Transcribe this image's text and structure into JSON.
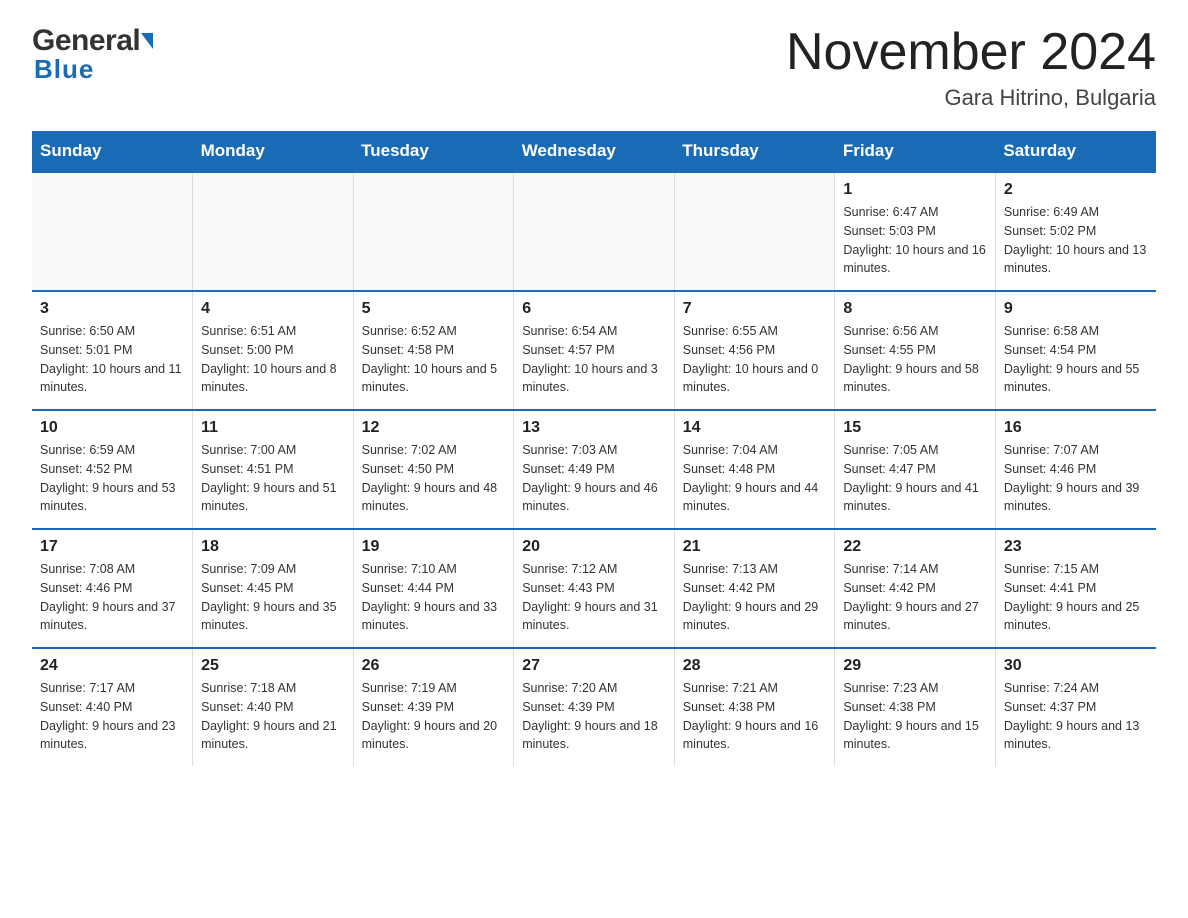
{
  "header": {
    "title": "November 2024",
    "subtitle": "Gara Hitrino, Bulgaria",
    "logo_general": "General",
    "logo_blue": "Blue"
  },
  "days_of_week": [
    "Sunday",
    "Monday",
    "Tuesday",
    "Wednesday",
    "Thursday",
    "Friday",
    "Saturday"
  ],
  "weeks": [
    [
      {
        "day": "",
        "info": ""
      },
      {
        "day": "",
        "info": ""
      },
      {
        "day": "",
        "info": ""
      },
      {
        "day": "",
        "info": ""
      },
      {
        "day": "",
        "info": ""
      },
      {
        "day": "1",
        "info": "Sunrise: 6:47 AM\nSunset: 5:03 PM\nDaylight: 10 hours and 16 minutes."
      },
      {
        "day": "2",
        "info": "Sunrise: 6:49 AM\nSunset: 5:02 PM\nDaylight: 10 hours and 13 minutes."
      }
    ],
    [
      {
        "day": "3",
        "info": "Sunrise: 6:50 AM\nSunset: 5:01 PM\nDaylight: 10 hours and 11 minutes."
      },
      {
        "day": "4",
        "info": "Sunrise: 6:51 AM\nSunset: 5:00 PM\nDaylight: 10 hours and 8 minutes."
      },
      {
        "day": "5",
        "info": "Sunrise: 6:52 AM\nSunset: 4:58 PM\nDaylight: 10 hours and 5 minutes."
      },
      {
        "day": "6",
        "info": "Sunrise: 6:54 AM\nSunset: 4:57 PM\nDaylight: 10 hours and 3 minutes."
      },
      {
        "day": "7",
        "info": "Sunrise: 6:55 AM\nSunset: 4:56 PM\nDaylight: 10 hours and 0 minutes."
      },
      {
        "day": "8",
        "info": "Sunrise: 6:56 AM\nSunset: 4:55 PM\nDaylight: 9 hours and 58 minutes."
      },
      {
        "day": "9",
        "info": "Sunrise: 6:58 AM\nSunset: 4:54 PM\nDaylight: 9 hours and 55 minutes."
      }
    ],
    [
      {
        "day": "10",
        "info": "Sunrise: 6:59 AM\nSunset: 4:52 PM\nDaylight: 9 hours and 53 minutes."
      },
      {
        "day": "11",
        "info": "Sunrise: 7:00 AM\nSunset: 4:51 PM\nDaylight: 9 hours and 51 minutes."
      },
      {
        "day": "12",
        "info": "Sunrise: 7:02 AM\nSunset: 4:50 PM\nDaylight: 9 hours and 48 minutes."
      },
      {
        "day": "13",
        "info": "Sunrise: 7:03 AM\nSunset: 4:49 PM\nDaylight: 9 hours and 46 minutes."
      },
      {
        "day": "14",
        "info": "Sunrise: 7:04 AM\nSunset: 4:48 PM\nDaylight: 9 hours and 44 minutes."
      },
      {
        "day": "15",
        "info": "Sunrise: 7:05 AM\nSunset: 4:47 PM\nDaylight: 9 hours and 41 minutes."
      },
      {
        "day": "16",
        "info": "Sunrise: 7:07 AM\nSunset: 4:46 PM\nDaylight: 9 hours and 39 minutes."
      }
    ],
    [
      {
        "day": "17",
        "info": "Sunrise: 7:08 AM\nSunset: 4:46 PM\nDaylight: 9 hours and 37 minutes."
      },
      {
        "day": "18",
        "info": "Sunrise: 7:09 AM\nSunset: 4:45 PM\nDaylight: 9 hours and 35 minutes."
      },
      {
        "day": "19",
        "info": "Sunrise: 7:10 AM\nSunset: 4:44 PM\nDaylight: 9 hours and 33 minutes."
      },
      {
        "day": "20",
        "info": "Sunrise: 7:12 AM\nSunset: 4:43 PM\nDaylight: 9 hours and 31 minutes."
      },
      {
        "day": "21",
        "info": "Sunrise: 7:13 AM\nSunset: 4:42 PM\nDaylight: 9 hours and 29 minutes."
      },
      {
        "day": "22",
        "info": "Sunrise: 7:14 AM\nSunset: 4:42 PM\nDaylight: 9 hours and 27 minutes."
      },
      {
        "day": "23",
        "info": "Sunrise: 7:15 AM\nSunset: 4:41 PM\nDaylight: 9 hours and 25 minutes."
      }
    ],
    [
      {
        "day": "24",
        "info": "Sunrise: 7:17 AM\nSunset: 4:40 PM\nDaylight: 9 hours and 23 minutes."
      },
      {
        "day": "25",
        "info": "Sunrise: 7:18 AM\nSunset: 4:40 PM\nDaylight: 9 hours and 21 minutes."
      },
      {
        "day": "26",
        "info": "Sunrise: 7:19 AM\nSunset: 4:39 PM\nDaylight: 9 hours and 20 minutes."
      },
      {
        "day": "27",
        "info": "Sunrise: 7:20 AM\nSunset: 4:39 PM\nDaylight: 9 hours and 18 minutes."
      },
      {
        "day": "28",
        "info": "Sunrise: 7:21 AM\nSunset: 4:38 PM\nDaylight: 9 hours and 16 minutes."
      },
      {
        "day": "29",
        "info": "Sunrise: 7:23 AM\nSunset: 4:38 PM\nDaylight: 9 hours and 15 minutes."
      },
      {
        "day": "30",
        "info": "Sunrise: 7:24 AM\nSunset: 4:37 PM\nDaylight: 9 hours and 13 minutes."
      }
    ]
  ]
}
